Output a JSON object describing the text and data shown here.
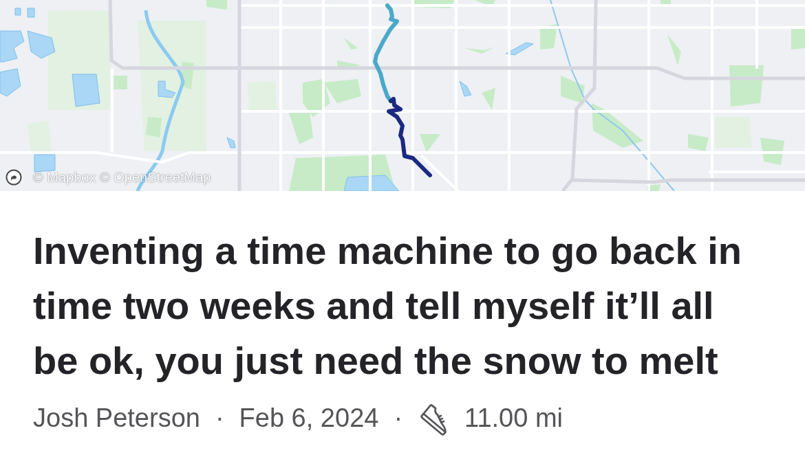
{
  "map": {
    "attribution": "© Mapbox © OpenStreetMap"
  },
  "activity": {
    "title": "Inventing a time machine to go back in time two weeks and tell myself it’ll all be ok, you just need the snow to melt",
    "meta": [
      {
        "kind": "athlete",
        "text": "Josh Peterson"
      },
      {
        "kind": "separator",
        "text": "·"
      },
      {
        "kind": "date",
        "text": "Feb 6, 2024"
      },
      {
        "kind": "separator",
        "text": "·"
      },
      {
        "kind": "distance",
        "text": "11.00 mi"
      }
    ]
  }
}
